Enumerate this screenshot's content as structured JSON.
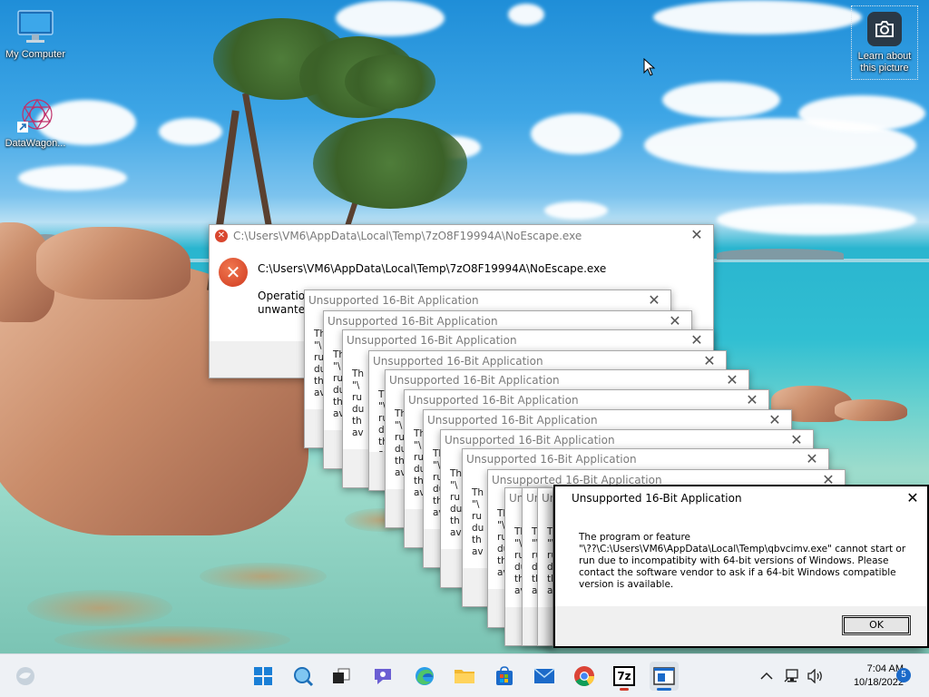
{
  "desktop": {
    "icons": [
      {
        "label": "My Computer",
        "icon": "monitor-icon"
      },
      {
        "label": "DataWagon...",
        "icon": "datawagon-shortcut-icon"
      }
    ],
    "learn_about": "Learn about\nthis picture"
  },
  "error_dialog": {
    "title": "C:\\Users\\VM6\\AppData\\Local\\Temp\\7zO8F19994A\\NoEscape.exe",
    "path": "C:\\Users\\VM6\\AppData\\Local\\Temp\\7zO8F19994A\\NoEscape.exe",
    "message_line1": "Operation",
    "message_line2": "unwanted"
  },
  "stacked_dialog_title": "Unsupported 16-Bit Application",
  "stacked_dialog_fragments": [
    "Th",
    "\"\\",
    "ru",
    "du",
    "th",
    "av"
  ],
  "front_dialog": {
    "title": "Unsupported 16-Bit Application",
    "message": "The program or feature\n\"\\??\\C:\\Users\\VM6\\AppData\\Local\\Temp\\qbvcimv.exe\" cannot start or\nrun due to incompatibity with 64-bit versions of Windows. Please\ncontact the software vendor to ask if a 64-bit Windows compatible\nversion is available.",
    "ok_label": "OK"
  },
  "taskbar": {
    "items": [
      "widgets-icon",
      "start-icon",
      "search-icon",
      "task-view-icon",
      "teams-chat-icon",
      "edge-icon",
      "file-explorer-icon",
      "store-icon",
      "mail-icon",
      "chrome-icon",
      "7zip-icon",
      "app-window-icon"
    ],
    "seven_zip_label": "7z",
    "time": "7:04 AM",
    "date": "10/18/2022",
    "notification_count": "5"
  },
  "colors": {
    "taskbar_bg": "#eef1f5",
    "accent": "#1b6ac9",
    "error_red": "#d9472f"
  }
}
